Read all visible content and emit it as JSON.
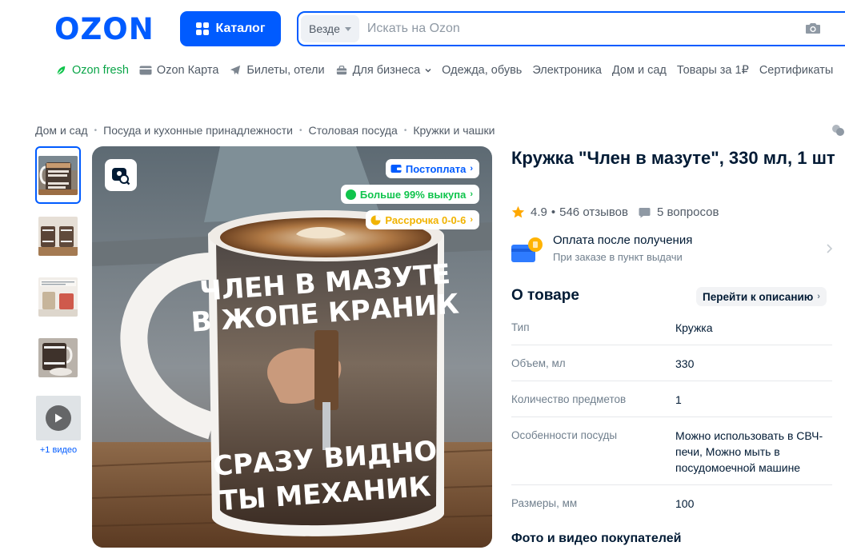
{
  "header": {
    "logo": "OZON",
    "catalog_label": "Каталог",
    "search_scope": "Везде",
    "search_placeholder": "Искать на Ozon"
  },
  "topnav": [
    {
      "label": "Ozon fresh",
      "icon": "leaf-icon"
    },
    {
      "label": "Ozon Карта",
      "icon": "card-icon"
    },
    {
      "label": "Билеты, отели",
      "icon": "plane-icon"
    },
    {
      "label": "Для бизнеса",
      "icon": "briefcase-icon"
    },
    {
      "label": "Одежда, обувь"
    },
    {
      "label": "Электроника"
    },
    {
      "label": "Дом и сад"
    },
    {
      "label": "Товары за 1₽"
    },
    {
      "label": "Сертификаты"
    }
  ],
  "breadcrumb": [
    "Дом и сад",
    "Посуда и кухонные принадлежности",
    "Столовая посуда",
    "Кружки и чашки"
  ],
  "gallery": {
    "video_label": "+1 видео",
    "badges": [
      "Постоплата",
      "Больше 99% выкупа",
      "Рассрочка 0-0-6"
    ],
    "mug_text": [
      "ЧЛЕН В МАЗУТЕ",
      "В ЖОПЕ КРАНИК",
      "СРАЗУ ВИДНО",
      "ТЫ МЕХАНИК"
    ]
  },
  "product": {
    "title": "Кружка \"Член в мазуте\", 330 мл, 1 шт",
    "rating": "4.9",
    "reviews": "546 отзывов",
    "questions": "5 вопросов",
    "payment_title": "Оплата после получения",
    "payment_subtitle": "При заказе в пункт выдачи",
    "about_title": "О товаре",
    "goto_description": "Перейти к описанию",
    "specs": [
      {
        "key": "Тип",
        "value": "Кружка"
      },
      {
        "key": "Объем, мл",
        "value": "330"
      },
      {
        "key": "Количество предметов",
        "value": "1"
      },
      {
        "key": "Особенности посуды",
        "value": "Можно использовать в СВЧ-печи, Можно мыть в посудомоечной машине"
      },
      {
        "key": "Размеры, мм",
        "value": "100"
      }
    ],
    "photos_title": "Фото и видео покупателей"
  },
  "colors": {
    "brand": "#005bff",
    "green": "#10c44c",
    "orange": "#f1b300"
  }
}
